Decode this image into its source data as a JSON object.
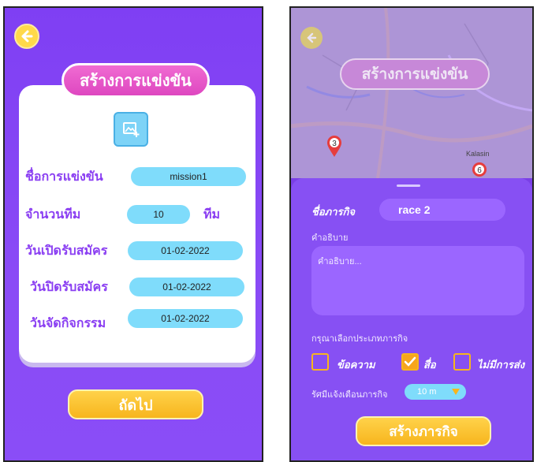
{
  "left": {
    "title": "สร้างการแข่งขัน",
    "rows": [
      {
        "label": "ชื่อการแข่งขัน",
        "value": "mission1"
      },
      {
        "label": "จำนวนทีม",
        "value": "10",
        "suffix": "ทีม"
      },
      {
        "label": "วันเปิดรับสมัคร",
        "value": "01-02-2022"
      },
      {
        "label": "วันปิดรับสมัคร",
        "value": "01-02-2022"
      },
      {
        "label": "วันจัดกิจกรรม",
        "value": "01-02-2022"
      }
    ],
    "next_label": "ถัดไป"
  },
  "right": {
    "title": "สร้างการแข่งขัน",
    "map": {
      "place": "Kalasin",
      "markers": [
        "3",
        "6"
      ]
    },
    "mission_name_label": "ชื่อภารกิจ",
    "mission_name_value": "race 2",
    "description_label": "คำอธิบาย",
    "description_placeholder": "คำอธิบาย...",
    "type_prompt": "กรุณาเลือกประเภทภารกิจ",
    "options": [
      {
        "label": "ข้อความ",
        "checked": false
      },
      {
        "label": "สื่อ",
        "checked": true
      },
      {
        "label": "ไม่มีการส่ง",
        "checked": false
      }
    ],
    "radius_label": "รัศมีแจ้งเตือนภารกิจ",
    "radius_value": "10 m",
    "create_label": "สร้างภารกิจ"
  },
  "colors": {
    "purple": "#8750f3",
    "pink": "#e356c7",
    "cyan": "#7fdcfb",
    "yellow": "#f7b51d",
    "label_purple": "#8a3ef2"
  }
}
